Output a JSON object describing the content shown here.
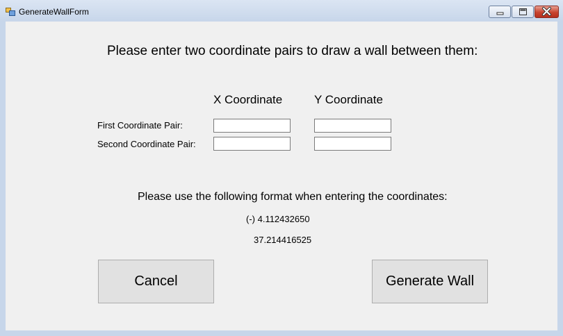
{
  "window": {
    "title": "GenerateWallForm",
    "icon": "form-icon",
    "controls": [
      "minimize-icon",
      "maximize-icon",
      "close-icon"
    ]
  },
  "form": {
    "heading": "Please enter two coordinate pairs to draw a wall between them:",
    "columns": {
      "x_label": "X Coordinate",
      "y_label": "Y Coordinate"
    },
    "rows": [
      {
        "label": "First Coordinate Pair:",
        "x_value": "",
        "y_value": ""
      },
      {
        "label": "Second Coordinate Pair:",
        "x_value": "",
        "y_value": ""
      }
    ],
    "format_label": "Please use the following format when entering the coordinates:",
    "format_example_1": "(-) 4.112432650",
    "format_example_2": "37.214416525"
  },
  "buttons": {
    "cancel_label": "Cancel",
    "generate_label": "Generate Wall"
  },
  "colors": {
    "form_background": "#f0f0f0",
    "frame": "#c7d6ea",
    "button_face": "#e1e1e1",
    "close_button": "#c8442f"
  }
}
